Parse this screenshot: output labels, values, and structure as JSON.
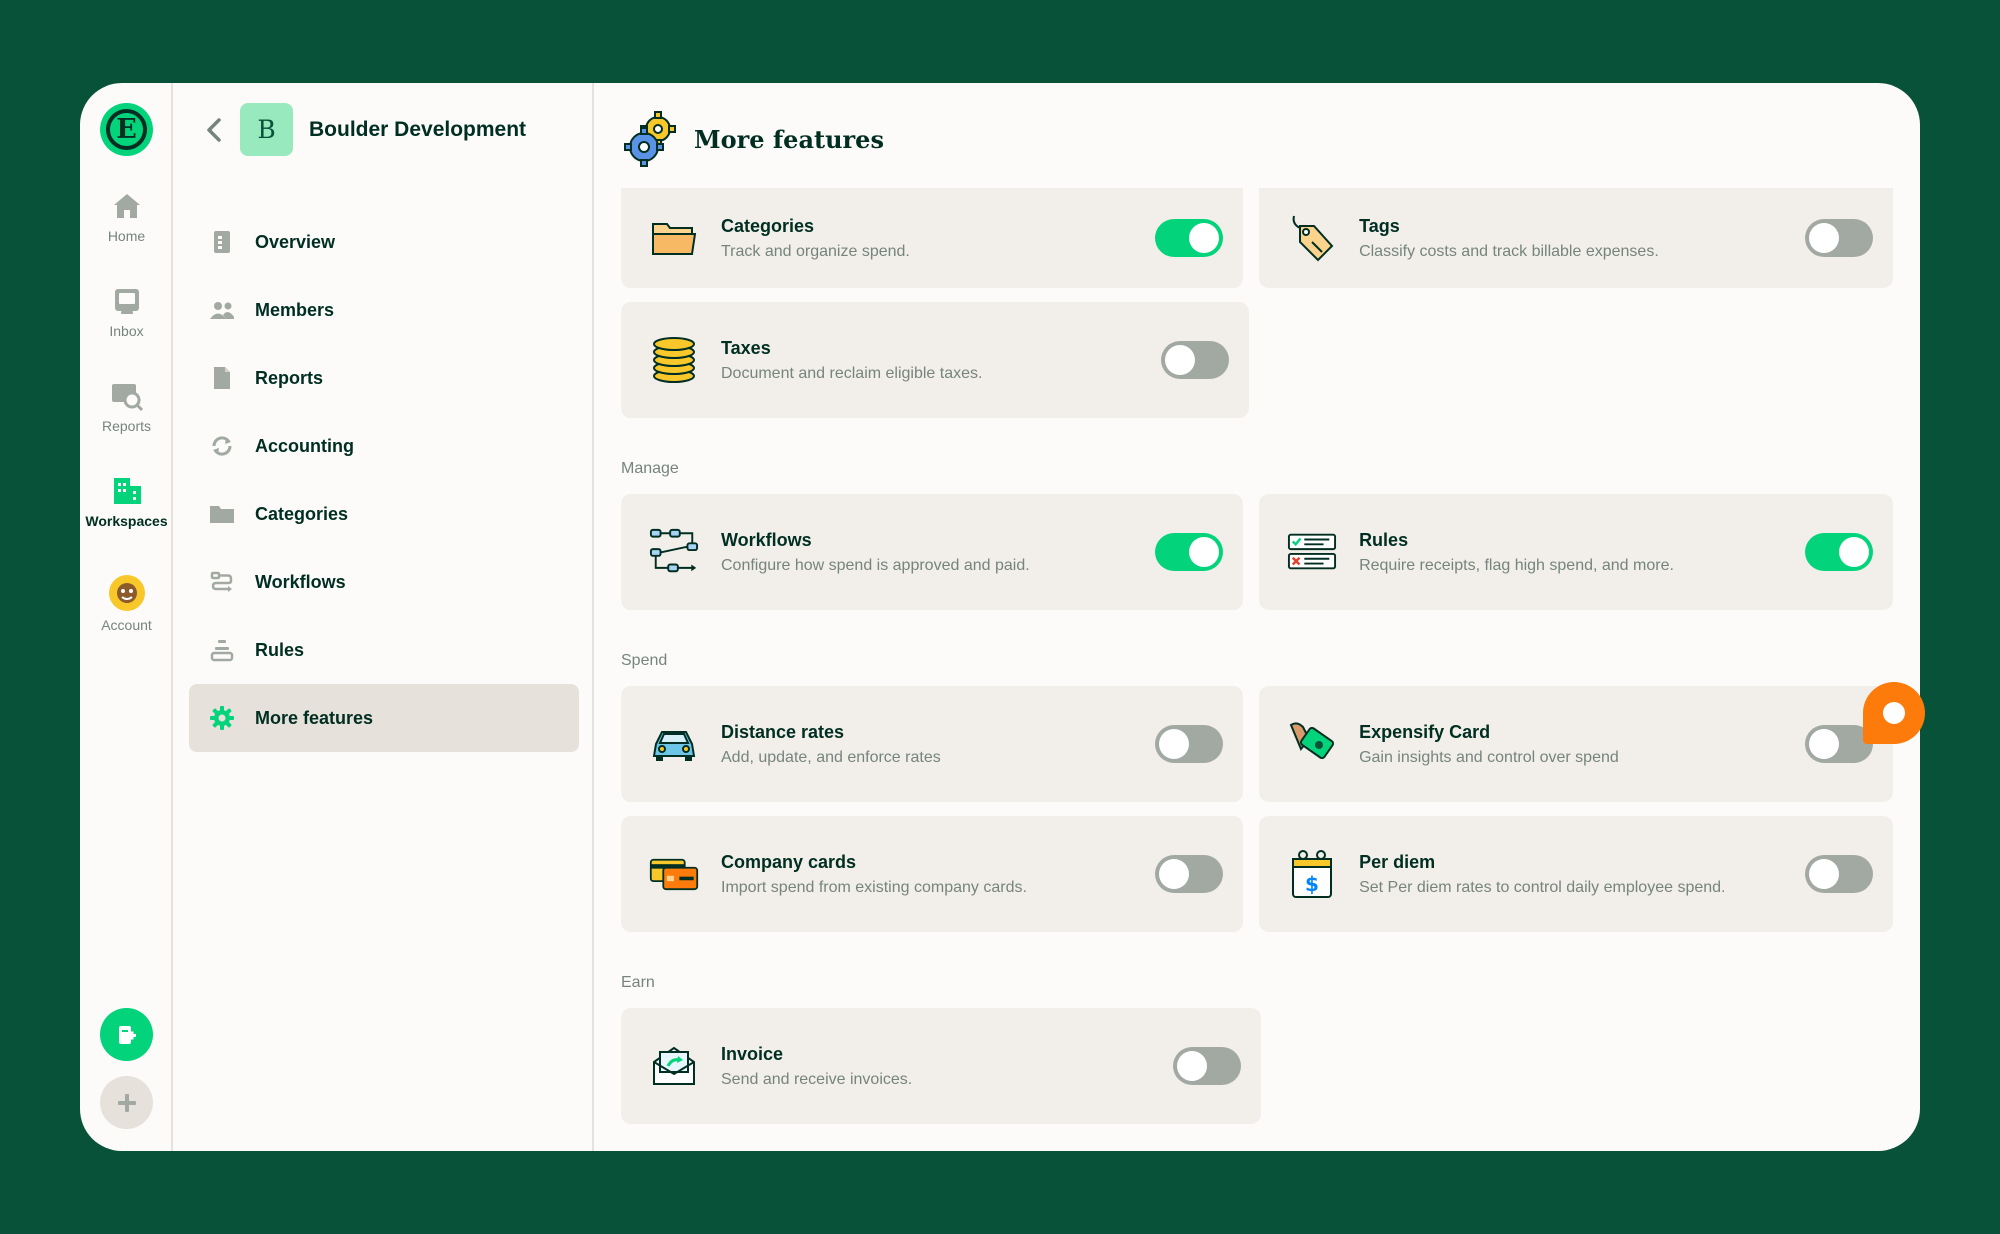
{
  "rail": {
    "items": [
      {
        "label": "Home",
        "icon": "home-icon"
      },
      {
        "label": "Inbox",
        "icon": "inbox-icon"
      },
      {
        "label": "Reports",
        "icon": "reports-search-icon"
      },
      {
        "label": "Workspaces",
        "icon": "building-icon",
        "active": true
      },
      {
        "label": "Account",
        "icon": "account-avatar"
      }
    ]
  },
  "workspace": {
    "avatar_letter": "B",
    "name": "Boulder Development"
  },
  "menu": [
    {
      "label": "Overview",
      "icon": "document-icon"
    },
    {
      "label": "Members",
      "icon": "users-icon"
    },
    {
      "label": "Reports",
      "icon": "report-icon"
    },
    {
      "label": "Accounting",
      "icon": "sync-icon"
    },
    {
      "label": "Categories",
      "icon": "folder-icon"
    },
    {
      "label": "Workflows",
      "icon": "workflow-icon"
    },
    {
      "label": "Rules",
      "icon": "rules-icon"
    },
    {
      "label": "More features",
      "icon": "gear-icon",
      "active": true
    }
  ],
  "page": {
    "title": "More features"
  },
  "features": {
    "categories": {
      "title": "Categories",
      "desc": "Track and organize spend.",
      "enabled": true
    },
    "tags": {
      "title": "Tags",
      "desc": "Classify costs and track billable expenses.",
      "enabled": false
    },
    "taxes": {
      "title": "Taxes",
      "desc": "Document and reclaim eligible taxes.",
      "enabled": false
    },
    "workflows": {
      "title": "Workflows",
      "desc": "Configure how spend is approved and paid.",
      "enabled": true
    },
    "rules": {
      "title": "Rules",
      "desc": "Require receipts, flag high spend, and more.",
      "enabled": true
    },
    "distance": {
      "title": "Distance rates",
      "desc": "Add, update, and enforce rates",
      "enabled": false
    },
    "card": {
      "title": "Expensify Card",
      "desc": "Gain insights and control over spend",
      "enabled": false
    },
    "company_cards": {
      "title": "Company cards",
      "desc": "Import spend from existing company cards.",
      "enabled": false
    },
    "per_diem": {
      "title": "Per diem",
      "desc": "Set Per diem rates to control daily employee spend.",
      "enabled": false
    },
    "invoice": {
      "title": "Invoice",
      "desc": "Send and receive invoices.",
      "enabled": false
    }
  },
  "sections": {
    "manage": "Manage",
    "spend": "Spend",
    "earn": "Earn"
  },
  "colors": {
    "background": "#085239",
    "accent_green": "#03d47c",
    "help_orange": "#fd7b0a"
  }
}
